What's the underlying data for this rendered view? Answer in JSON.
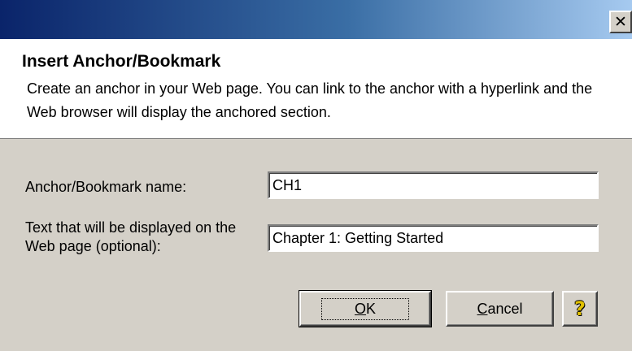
{
  "window": {
    "close_glyph": "✕"
  },
  "header": {
    "title": "Insert Anchor/Bookmark",
    "description": "Create an anchor in your Web page.  You can link to the anchor with a hyperlink and the Web browser will display the anchored section."
  },
  "form": {
    "anchor_label": "Anchor/Bookmark name:",
    "anchor_value": "CH1",
    "text_label": "Text that will be displayed on the Web page (optional):",
    "text_value": "Chapter 1: Getting Started"
  },
  "buttons": {
    "ok_mnemonic": "O",
    "ok_rest": "K",
    "cancel_mnemonic": "C",
    "cancel_rest": "ancel",
    "help_glyph": "?"
  },
  "colors": {
    "titlebar_start": "#0a246a",
    "titlebar_end": "#a6caf0",
    "face": "#d4d0c8",
    "help_icon": "#e0c000"
  }
}
